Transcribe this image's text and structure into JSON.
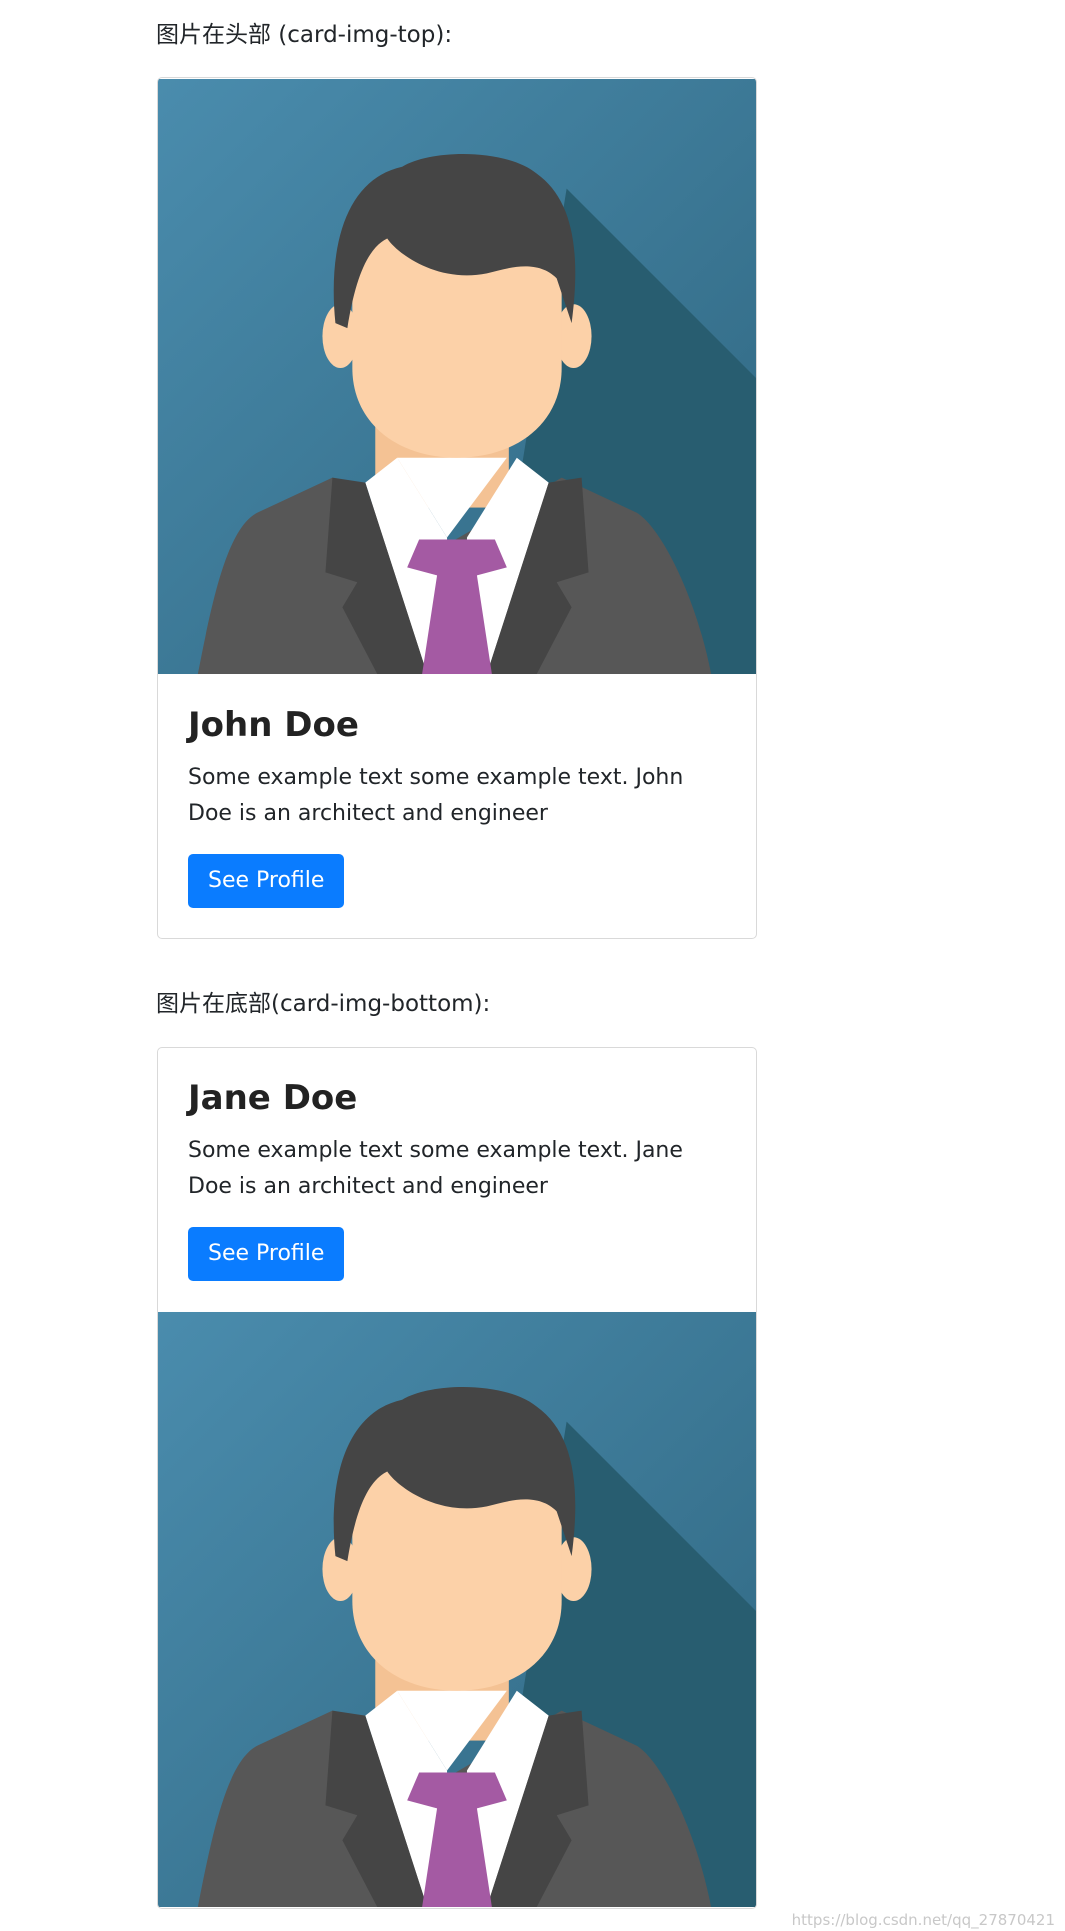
{
  "section_top": {
    "label": "图片在头部 (card-img-top):",
    "card": {
      "title": "John Doe",
      "text": "Some example text some example text. John Doe is an architect and engineer",
      "button": "See Profile"
    }
  },
  "section_bottom": {
    "label": "图片在底部(card-img-bottom):",
    "card": {
      "title": "Jane Doe",
      "text": "Some example text some example text. Jane Doe is an architect and engineer",
      "button": "See Profile"
    }
  },
  "watermark": "https://blog.csdn.net/qq_27870421",
  "colors": {
    "button": "#0a7cff",
    "avatar_bg": "#3f7f9c",
    "avatar_shadow": "#285d70",
    "skin": "#fcd1a8",
    "hair": "#454545",
    "suit": "#575757",
    "tie": "#a45aa3"
  }
}
